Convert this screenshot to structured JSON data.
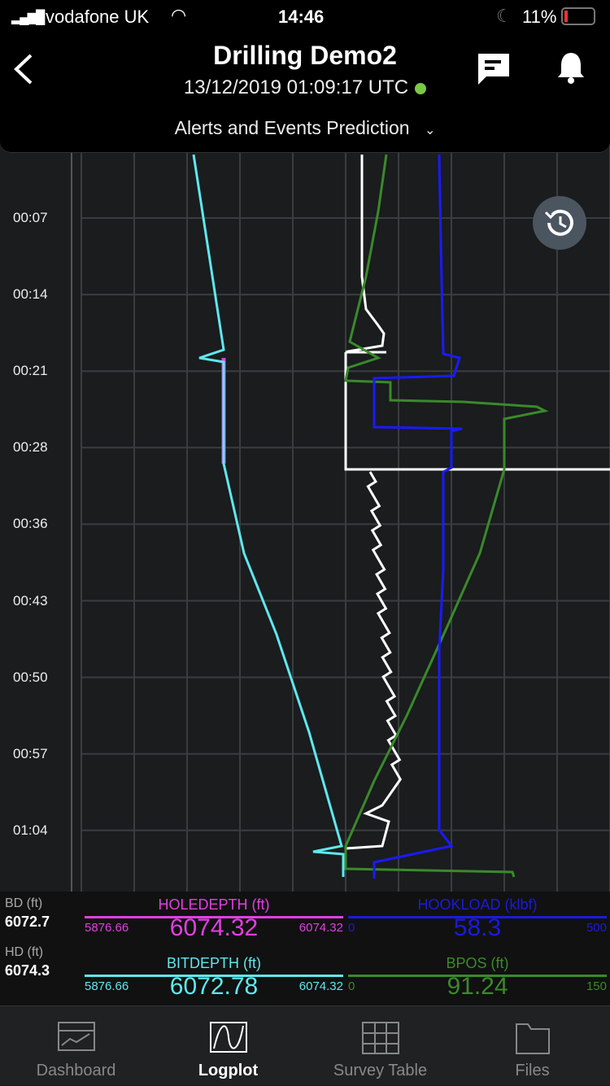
{
  "status": {
    "carrier": "vodafone UK",
    "time": "14:46",
    "battery": "11%"
  },
  "header": {
    "title": "Drilling Demo2",
    "timestamp": "13/12/2019 01:09:17 UTC",
    "live_color": "#7ac943",
    "dropdown": "Alerts and Events Prediction"
  },
  "plot": {
    "time_labels": [
      "00:07",
      "00:14",
      "00:21",
      "00:28",
      "00:36",
      "00:43",
      "00:50",
      "00:57",
      "01:04"
    ],
    "colors": {
      "holedepth": "#e040e0",
      "bitdepth": "#5ee8ee",
      "hookload": "#1a1aff",
      "bpos": "#3a8a2a",
      "other": "#ffffff"
    }
  },
  "readouts": {
    "bd_label": "BD (ft)",
    "bd_value": "6072.7",
    "hd_label": "HD (ft)",
    "hd_value": "6074.3"
  },
  "gauges": [
    {
      "name": "HOLEDEPTH (ft)",
      "min": "5876.66",
      "value": "6074.32",
      "max": "6074.32",
      "color": "#e040e0"
    },
    {
      "name": "HOOKLOAD (klbf)",
      "min": "0",
      "value": "58.3",
      "max": "500",
      "color": "#1a1ae0"
    },
    {
      "name": "BITDEPTH (ft)",
      "min": "5876.66",
      "value": "6072.78",
      "max": "6074.32",
      "color": "#5ee8ee"
    },
    {
      "name": "BPOS (ft)",
      "min": "0",
      "value": "91.24",
      "max": "150",
      "color": "#3a8a2a"
    }
  ],
  "nav": [
    {
      "label": "Dashboard"
    },
    {
      "label": "Logplot",
      "active": true
    },
    {
      "label": "Survey Table"
    },
    {
      "label": "Files"
    }
  ]
}
